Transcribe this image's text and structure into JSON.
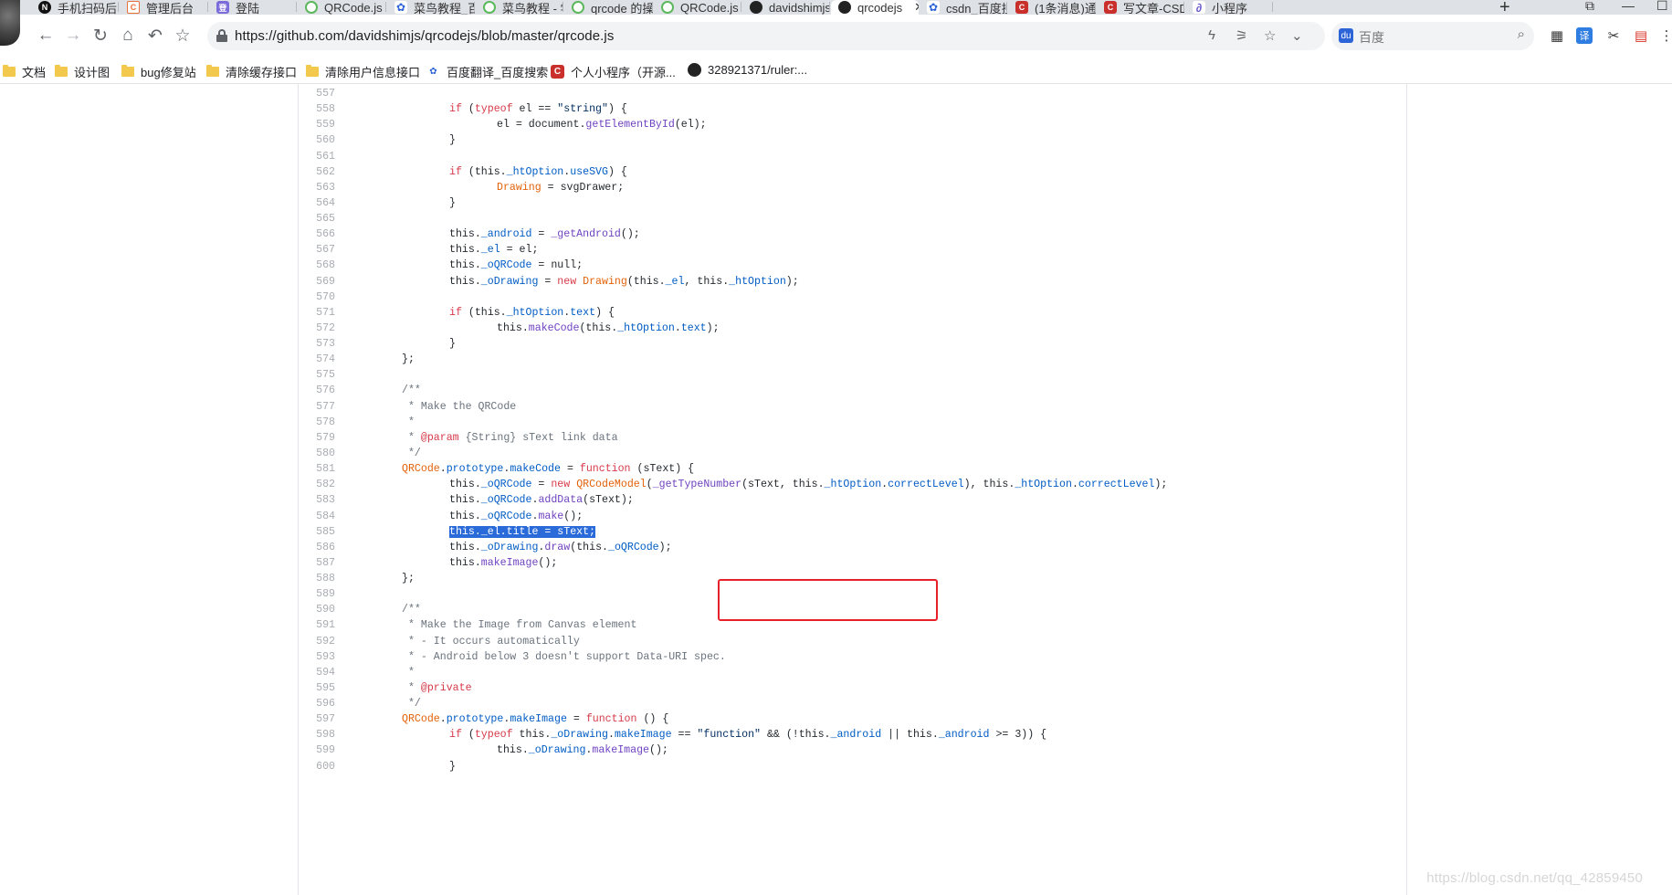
{
  "browser": {
    "tabs": [
      {
        "title": "手机扫码后",
        "icon": "notion-icon"
      },
      {
        "title": "管理后台",
        "icon": "admin-icon"
      },
      {
        "title": "登陆",
        "icon": "login-icon"
      },
      {
        "title": "QRCode.js",
        "icon": "runoob-icon"
      },
      {
        "title": "菜鸟教程_百",
        "icon": "baidu-icon"
      },
      {
        "title": "菜鸟教程 - 学",
        "icon": "runoob-icon"
      },
      {
        "title": "qrcode 的操",
        "icon": "runoob-icon"
      },
      {
        "title": "QRCode.js",
        "icon": "runoob-icon"
      },
      {
        "title": "davidshimjs",
        "icon": "github-icon"
      },
      {
        "title": "qrcodejs",
        "icon": "github-icon",
        "active": true
      },
      {
        "title": "csdn_百度搜",
        "icon": "baidu-icon"
      },
      {
        "title": "(1条消息)通",
        "icon": "csdn-icon"
      },
      {
        "title": "写文章-CSDN",
        "icon": "csdn-icon"
      },
      {
        "title": "小程序",
        "icon": "miniprogram-icon"
      }
    ],
    "url": "https://github.com/davidshimjs/qrcodejs/blob/master/qrcode.js",
    "search_placeholder": "百度",
    "bookmarks": [
      {
        "label": "文档",
        "icon": "folder-icon"
      },
      {
        "label": "设计图",
        "icon": "folder-icon"
      },
      {
        "label": "bug修复站",
        "icon": "folder-icon"
      },
      {
        "label": "清除缓存接口",
        "icon": "folder-icon"
      },
      {
        "label": "清除用户信息接口",
        "icon": "folder-icon"
      },
      {
        "label": "百度翻译_百度搜索",
        "icon": "baidu-icon"
      },
      {
        "label": "个人小程序（开源...",
        "icon": "csdn-icon"
      },
      {
        "label": "328921371/ruler:...",
        "icon": "github-icon"
      }
    ]
  },
  "code": {
    "lines": [
      {
        "n": "557",
        "t": ""
      },
      {
        "n": "558",
        "t": "\t\tif (typeof el == \"string\") {"
      },
      {
        "n": "559",
        "t": "\t\t\tel = document.getElementById(el);"
      },
      {
        "n": "560",
        "t": "\t\t}"
      },
      {
        "n": "561",
        "t": ""
      },
      {
        "n": "562",
        "t": "\t\tif (this._htOption.useSVG) {"
      },
      {
        "n": "563",
        "t": "\t\t\tDrawing = svgDrawer;"
      },
      {
        "n": "564",
        "t": "\t\t}"
      },
      {
        "n": "565",
        "t": ""
      },
      {
        "n": "566",
        "t": "\t\tthis._android = _getAndroid();"
      },
      {
        "n": "567",
        "t": "\t\tthis._el = el;"
      },
      {
        "n": "568",
        "t": "\t\tthis._oQRCode = null;"
      },
      {
        "n": "569",
        "t": "\t\tthis._oDrawing = new Drawing(this._el, this._htOption);"
      },
      {
        "n": "570",
        "t": ""
      },
      {
        "n": "571",
        "t": "\t\tif (this._htOption.text) {"
      },
      {
        "n": "572",
        "t": "\t\t\tthis.makeCode(this._htOption.text);"
      },
      {
        "n": "573",
        "t": "\t\t}"
      },
      {
        "n": "574",
        "t": "\t};"
      },
      {
        "n": "575",
        "t": ""
      },
      {
        "n": "576",
        "t": "\t/**"
      },
      {
        "n": "577",
        "t": "\t * Make the QRCode"
      },
      {
        "n": "578",
        "t": "\t *"
      },
      {
        "n": "579",
        "t": "\t * @param {String} sText link data"
      },
      {
        "n": "580",
        "t": "\t */"
      },
      {
        "n": "581",
        "t": "\tQRCode.prototype.makeCode = function (sText) {"
      },
      {
        "n": "582",
        "t": "\t\tthis._oQRCode = new QRCodeModel(_getTypeNumber(sText, this._htOption.correctLevel), this._htOption.correctLevel);"
      },
      {
        "n": "583",
        "t": "\t\tthis._oQRCode.addData(sText);"
      },
      {
        "n": "584",
        "t": "\t\tthis._oQRCode.make();"
      },
      {
        "n": "585",
        "t": "\t\tthis._el.title = sText;",
        "selected": true
      },
      {
        "n": "586",
        "t": "\t\tthis._oDrawing.draw(this._oQRCode);"
      },
      {
        "n": "587",
        "t": "\t\tthis.makeImage();"
      },
      {
        "n": "588",
        "t": "\t};"
      },
      {
        "n": "589",
        "t": ""
      },
      {
        "n": "590",
        "t": "\t/**"
      },
      {
        "n": "591",
        "t": "\t * Make the Image from Canvas element"
      },
      {
        "n": "592",
        "t": "\t * - It occurs automatically"
      },
      {
        "n": "593",
        "t": "\t * - Android below 3 doesn't support Data-URI spec."
      },
      {
        "n": "594",
        "t": "\t *"
      },
      {
        "n": "595",
        "t": "\t * @private"
      },
      {
        "n": "596",
        "t": "\t */"
      },
      {
        "n": "597",
        "t": "\tQRCode.prototype.makeImage = function () {"
      },
      {
        "n": "598",
        "t": "\t\tif (typeof this._oDrawing.makeImage == \"function\" && (!this._android || this._android >= 3)) {"
      },
      {
        "n": "599",
        "t": "\t\t\tthis._oDrawing.makeImage();"
      },
      {
        "n": "600",
        "t": "\t\t}"
      }
    ]
  },
  "watermark": "https://blog.csdn.net/qq_42859450",
  "colors": {
    "highlight_box": "#e8202a",
    "selection": "#2a6ad9"
  }
}
